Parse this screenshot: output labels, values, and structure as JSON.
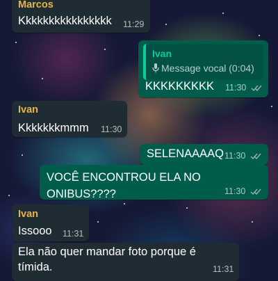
{
  "messages": [
    {
      "sender": "Marcos",
      "text": "Kkkkkkkkkkkkkkkk",
      "time": "11:29"
    },
    {
      "quote": {
        "sender": "Ivan",
        "text": "Message vocal (0:04)"
      },
      "text": "KKKKKKKKK",
      "time": "11:30"
    },
    {
      "sender": "Ivan",
      "text": "Kkkkkkkmmm",
      "time": "11:30"
    },
    {
      "text": "SELENAAAAQ",
      "time": "11:30"
    },
    {
      "text": "VOCÊ ENCONTROU ELA NO ONIBUS????",
      "time": "11:30"
    },
    {
      "sender": "Ivan",
      "text": "Issooo",
      "time": "11:31"
    },
    {
      "text_line1": "Ela não quer mandar foto porque é",
      "text_line2": "tímida.",
      "time": "11:31"
    }
  ],
  "colors": {
    "incoming_bubble": "#202c33",
    "outgoing_bubble": "#005c4b",
    "sender_name": "#e6b44a",
    "quote_accent": "#06cf9c",
    "read_ticks": "#9fb1b8"
  },
  "icons": {
    "microphone": "mic-icon",
    "read_receipt": "double-check-icon"
  }
}
